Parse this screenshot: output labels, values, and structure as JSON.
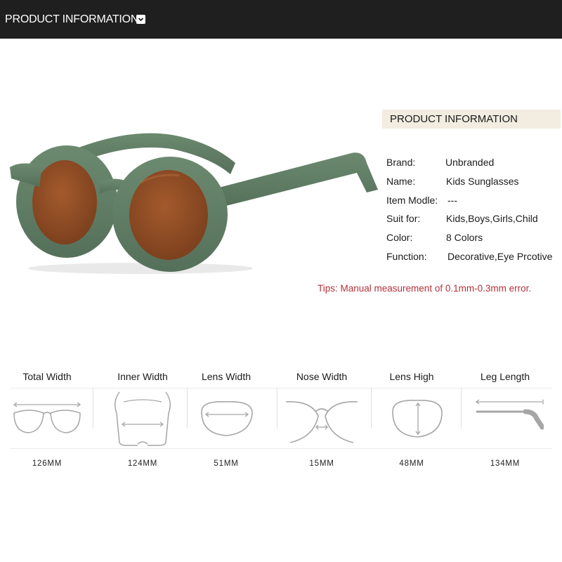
{
  "header": {
    "title": "PRODUCT INFORMATION",
    "toggle_icon": "chevron-down-icon"
  },
  "info": {
    "heading": "PRODUCT INFORMATION",
    "specs": [
      {
        "label": "Brand:",
        "value": "Unbranded"
      },
      {
        "label": "Name:",
        "value": "Kids Sunglasses"
      },
      {
        "label": "Item Modle:",
        "value": "---"
      },
      {
        "label": "Suit for:",
        "value": "Kids,Boys,Girls,Child"
      },
      {
        "label": "Color:",
        "value": "8 Colors"
      },
      {
        "label": "Function:",
        "value": "Decorative,Eye Prcotive"
      }
    ],
    "tips": "Tips: Manual measurement of 0.1mm-0.3mm error."
  },
  "measurements": [
    {
      "label": "Total Width",
      "value": "126MM",
      "icon": "total-width-icon"
    },
    {
      "label": "Inner Width",
      "value": "124MM",
      "icon": "inner-width-icon"
    },
    {
      "label": "Lens Width",
      "value": "51MM",
      "icon": "lens-width-icon"
    },
    {
      "label": "Nose Width",
      "value": "15MM",
      "icon": "nose-width-icon"
    },
    {
      "label": "Lens High",
      "value": "48MM",
      "icon": "lens-high-icon"
    },
    {
      "label": "Leg Length",
      "value": "134MM",
      "icon": "leg-length-icon"
    }
  ],
  "colors": {
    "header_bg": "#1f1f1f",
    "frame": "#5e7a62",
    "lens": "#8a4a24",
    "info_heading_bg": "#f2ece1",
    "tips": "#b3333a",
    "diagram_line": "#a6a6a6"
  }
}
